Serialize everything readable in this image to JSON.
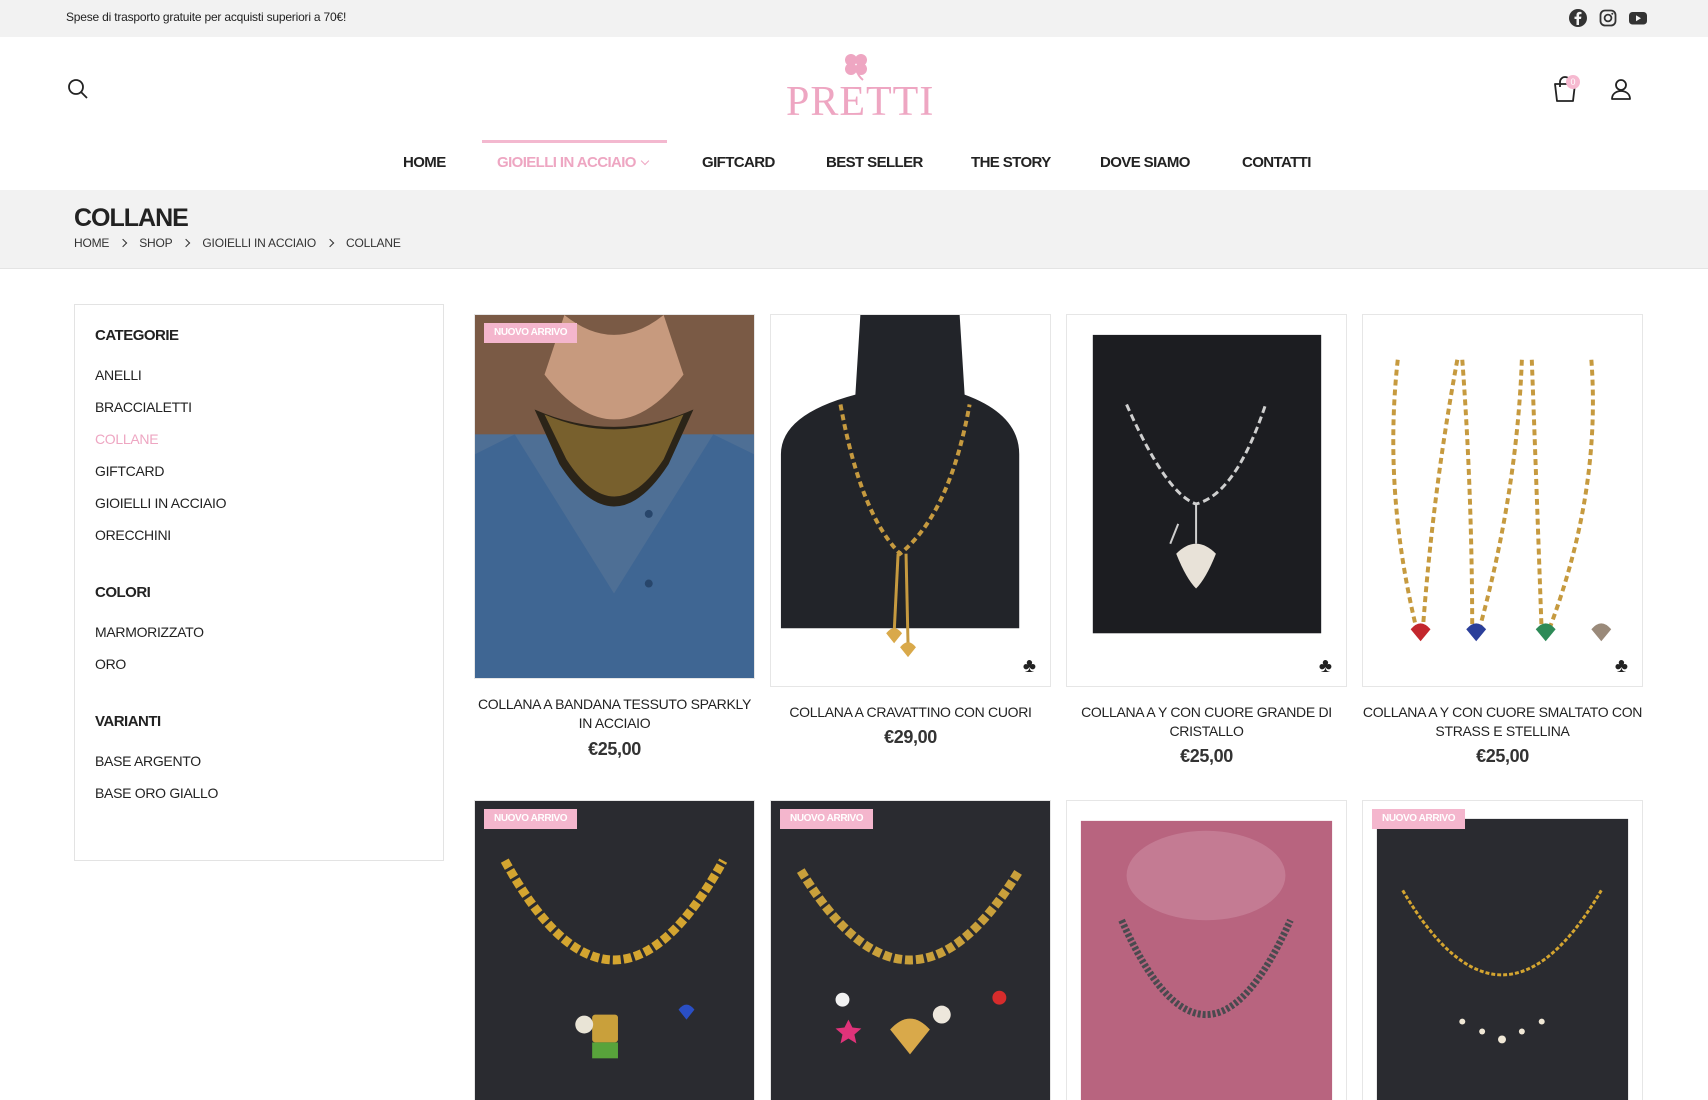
{
  "topbar": {
    "shipping_text": "Spese di trasporto gratuite per acquisti superiori a 70€!",
    "social": [
      "facebook-icon",
      "instagram-icon",
      "youtube-icon"
    ]
  },
  "header": {
    "logo_text": "PRETTI",
    "cart_count": "0",
    "icons": [
      "search-icon",
      "cart-icon",
      "user-icon"
    ]
  },
  "nav": {
    "items": [
      {
        "label": "HOME"
      },
      {
        "label": "GIOIELLI IN ACCIAIO"
      },
      {
        "label": "GIFTCARD"
      },
      {
        "label": "BEST SELLER"
      },
      {
        "label": "THE STORY"
      },
      {
        "label": "DOVE SIAMO"
      },
      {
        "label": "CONTATTI"
      }
    ],
    "active_index": 1
  },
  "page": {
    "title": "COLLANE",
    "breadcrumb": [
      "HOME",
      "SHOP",
      "GIOIELLI IN ACCIAIO",
      "COLLANE"
    ]
  },
  "sidebar": {
    "categories_title": "CATEGORIE",
    "categories": [
      "ANELLI",
      "BRACCIALETTI",
      "COLLANE",
      "GIFTCARD",
      "GIOIELLI IN ACCIAIO",
      "ORECCHINI"
    ],
    "active_category": "COLLANE",
    "colors_title": "COLORI",
    "colors": [
      "MARMORIZZATO",
      "ORO"
    ],
    "variants_title": "VARIANTI",
    "variants": [
      "BASE ARGENTO",
      "BASE ORO GIALLO"
    ]
  },
  "products": [
    {
      "name": "COLLANA A BANDANA TESSUTO SPARKLY IN ACCIAIO",
      "price": "€25,00",
      "badge": "NUOVO ARRIVO"
    },
    {
      "name": "COLLANA A CRAVATTINO CON CUORI",
      "price": "€29,00",
      "badge": ""
    },
    {
      "name": "COLLANA A Y CON CUORE GRANDE DI CRISTALLO",
      "price": "€25,00",
      "badge": ""
    },
    {
      "name": "COLLANA A Y CON CUORE SMALTATO CON STRASS E STELLINA",
      "price": "€25,00",
      "badge": ""
    },
    {
      "name": "",
      "price": "",
      "badge": "NUOVO ARRIVO"
    },
    {
      "name": "",
      "price": "",
      "badge": "NUOVO ARRIVO"
    },
    {
      "name": "",
      "price": "",
      "badge": ""
    },
    {
      "name": "",
      "price": "",
      "badge": "NUOVO ARRIVO"
    }
  ],
  "colors": {
    "accent_pink": "#eea6c2",
    "badge_pink": "#f4b6cd",
    "topbar_bg": "#f2f2f2"
  }
}
